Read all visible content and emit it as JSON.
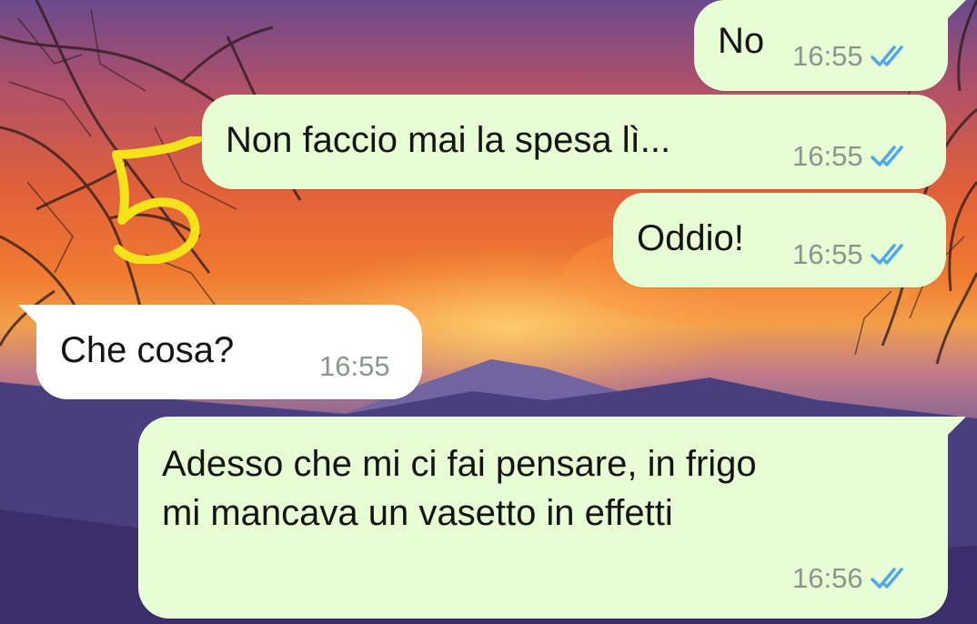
{
  "chat": {
    "messages": [
      {
        "direction": "outgoing",
        "text": "No",
        "time": "16:55",
        "status": "read",
        "status_icon": "double-check-icon"
      },
      {
        "direction": "outgoing",
        "text": "Non faccio mai la spesa lì...",
        "time": "16:55",
        "status": "read",
        "status_icon": "double-check-icon"
      },
      {
        "direction": "outgoing",
        "text": "Oddio!",
        "time": "16:55",
        "status": "read",
        "status_icon": "double-check-icon"
      },
      {
        "direction": "incoming",
        "text": "Che cosa?",
        "time": "16:55"
      },
      {
        "direction": "outgoing",
        "text": "Adesso che mi ci fai pensare, in frigo\nmi mancava un vasetto in effetti",
        "time": "16:56",
        "status": "read",
        "status_icon": "double-check-icon"
      }
    ]
  },
  "annotation": {
    "text": "5",
    "color": "#f5e21a"
  },
  "colors": {
    "outgoing_bubble": "#e7fdd3",
    "incoming_bubble": "#ffffff",
    "read_ticks": "#4fa8e8",
    "timestamp": "#8a968c"
  },
  "wallpaper": {
    "subject": "sunset over mountains with bare tree branches"
  }
}
